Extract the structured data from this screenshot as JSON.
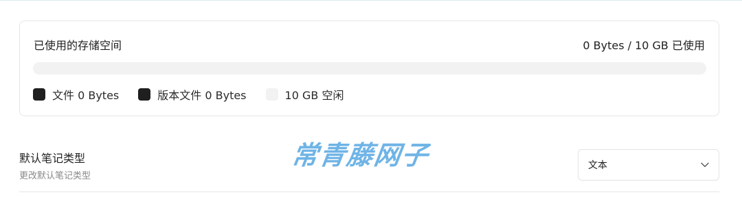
{
  "storage": {
    "title": "已使用的存储空间",
    "usage_text": "0 Bytes / 10 GB 已使用",
    "used_fraction": 0,
    "legend": [
      {
        "label": "文件 0 Bytes",
        "swatch": "#1f1f1f"
      },
      {
        "label": "版本文件 0 Bytes",
        "swatch": "#1f1f1f"
      },
      {
        "label": "10 GB 空闲",
        "swatch": "#f2f2f2"
      }
    ]
  },
  "default_note_type": {
    "title": "默认笔记类型",
    "description": "更改默认笔记类型",
    "selected": "文本"
  },
  "watermark": "常青藤网子",
  "colors": {
    "dark": "#1f1f1f",
    "track": "#f2f2f2",
    "border": "#e6e6e6",
    "watermark": "#6fb4e6"
  }
}
